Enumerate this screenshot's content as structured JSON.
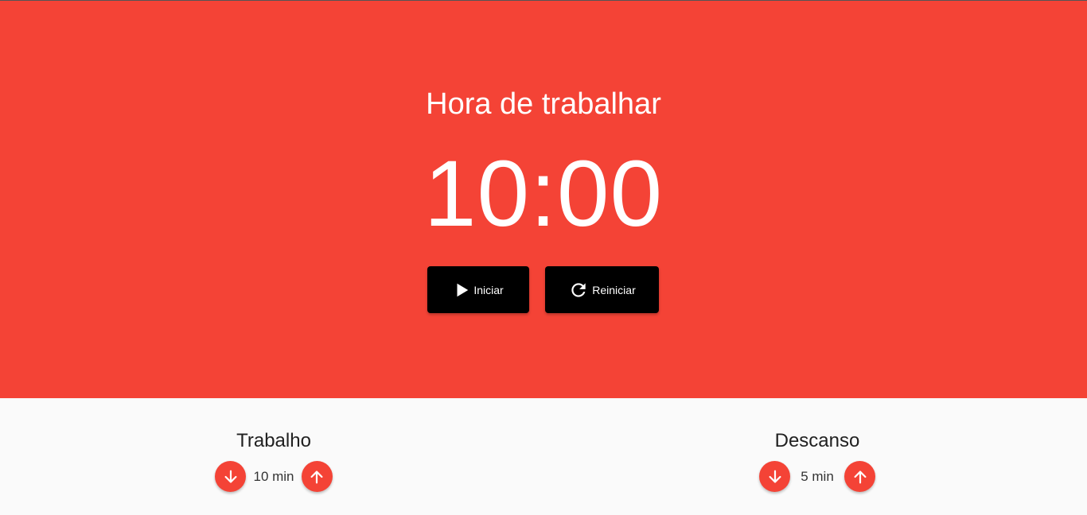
{
  "hero": {
    "title": "Hora de trabalhar",
    "time": "10:00",
    "background_color": "#f44336"
  },
  "controls": {
    "start_label": "Iniciar",
    "start_icon": "play-icon",
    "reset_label": "Reiniciar",
    "reset_icon": "refresh-icon"
  },
  "settings": {
    "work": {
      "title": "Trabalho",
      "value": "10 min",
      "decrease_icon": "arrow-down-icon",
      "increase_icon": "arrow-up-icon"
    },
    "rest": {
      "title": "Descanso",
      "value": "5 min",
      "decrease_icon": "arrow-down-icon",
      "increase_icon": "arrow-up-icon"
    }
  }
}
